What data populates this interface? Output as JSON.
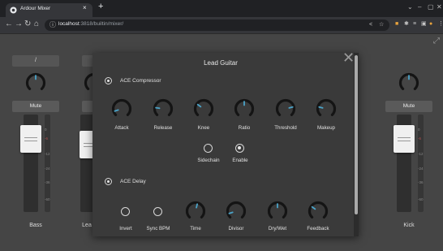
{
  "browser": {
    "tab_title": "Ardour Mixer",
    "tab_close": "×",
    "new_tab": "+",
    "url_host": "localhost",
    "url_path": ":3818/builtin/mixer/",
    "window_controls": [
      "⌄",
      "–",
      "▢",
      "✕"
    ]
  },
  "mixer": {
    "strips": [
      {
        "name": "/",
        "label": "Bass",
        "mute": "Mute",
        "fader_ticks": [
          "0",
          "-6",
          "-12",
          "-24",
          "-36",
          "-60"
        ],
        "pan_value": 0.5
      },
      {
        "name": "",
        "label": "Lea",
        "mute": "Mute",
        "fader_ticks": [],
        "pan_value": 0.5
      },
      {
        "name": "",
        "label": "Kick",
        "mute": "Mute",
        "fader_ticks": [
          "0",
          "-6",
          "-12",
          "-24",
          "-36",
          "-60"
        ],
        "pan_value": 0.5
      }
    ]
  },
  "modal": {
    "title": "Lead Guitar",
    "close_glyph": "✕",
    "plugins": [
      {
        "name": "ACE Compressor",
        "enabled": true,
        "knobs": [
          {
            "label": "Attack",
            "value": 0.1
          },
          {
            "label": "Release",
            "value": 0.2
          },
          {
            "label": "Knee",
            "value": 0.3
          },
          {
            "label": "Ratio",
            "value": 0.5
          },
          {
            "label": "Threshold",
            "value": 0.78
          },
          {
            "label": "Makeup",
            "value": 0.22
          }
        ],
        "toggles": [
          {
            "label": "Sidechain",
            "on": false
          },
          {
            "label": "Enable",
            "on": true
          }
        ]
      },
      {
        "name": "ACE Delay",
        "enabled": true,
        "toggles": [
          {
            "label": "Invert",
            "on": false
          },
          {
            "label": "Sync BPM",
            "on": false
          }
        ],
        "knobs": [
          {
            "label": "Time",
            "value": 0.55
          },
          {
            "label": "Divisor",
            "value": 0.1
          },
          {
            "label": "Dry/Wet",
            "value": 0.5
          },
          {
            "label": "Feedback",
            "value": 0.3
          }
        ]
      }
    ]
  },
  "colors": {
    "knob_ring": "#141414",
    "knob_marker": "#4aa3c8",
    "background": "#454545",
    "modal": "#3a3a3a"
  }
}
